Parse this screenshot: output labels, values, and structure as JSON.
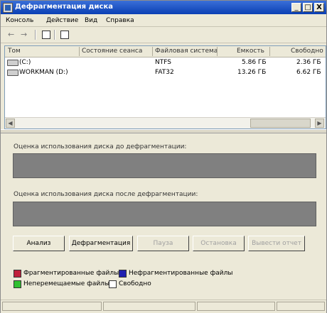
{
  "window": {
    "title": "Дефрагментация диска",
    "minimize": "_",
    "maximize": "□",
    "close": "X"
  },
  "menu": [
    "Консоль",
    "Действие",
    "Вид",
    "Справка"
  ],
  "toolbar": {
    "back": "←",
    "forward": "→"
  },
  "volumes": {
    "columns": [
      "Том",
      "Состояние сеанса",
      "Файловая система",
      "Емкость",
      "Свободно"
    ],
    "rows": [
      {
        "name": "(C:)",
        "status": "",
        "fs": "NTFS",
        "capacity": "5.86 ГБ",
        "free": "2.36 ГБ"
      },
      {
        "name": "WORKMAN (D:)",
        "status": "",
        "fs": "FAT32",
        "capacity": "13.26 ГБ",
        "free": "6.62 ГБ"
      }
    ]
  },
  "before_label": "Оценка использования диска до дефрагментации:",
  "after_label": "Оценка использования диска после дефрагментации:",
  "buttons": {
    "analyze": "Анализ",
    "defragment": "Дефрагментация",
    "pause": "Пауза",
    "stop": "Остановка",
    "report": "Вывести отчет"
  },
  "legend": {
    "fragmented": "Фрагментированные файлы",
    "contiguous": "Нефрагментированные файлы",
    "unmovable": "Неперемещаемые файлы",
    "free": "Свободно"
  },
  "colors": {
    "fragmented": "#c0203c",
    "contiguous": "#2020b0",
    "unmovable": "#30c030",
    "free": "#ffffff",
    "panel": "#808080",
    "title": "#0a3fb4"
  }
}
